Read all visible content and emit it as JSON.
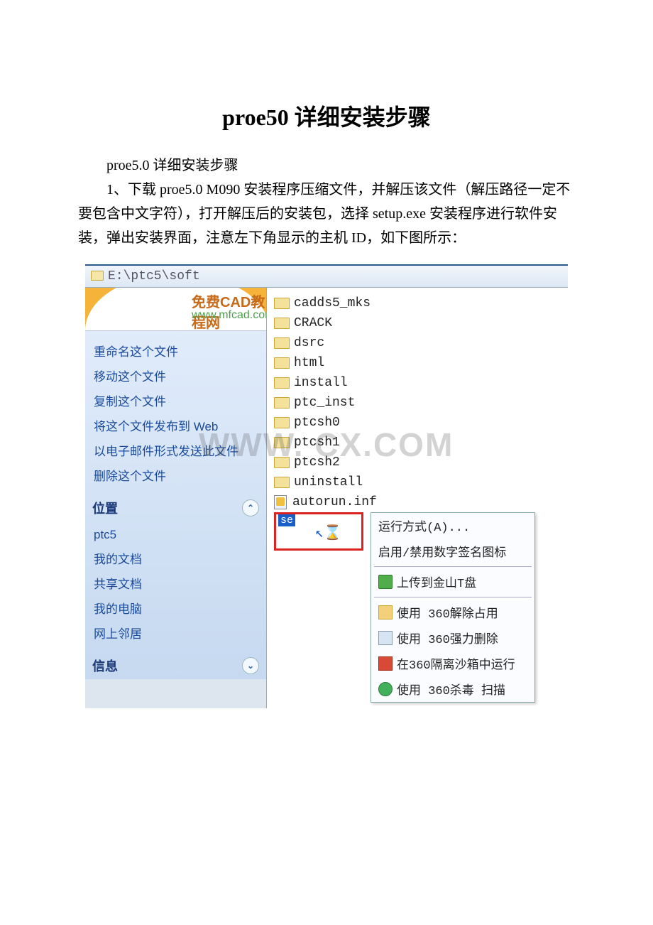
{
  "document": {
    "title": "proe50 详细安装步骤",
    "subtitle": "proe5.0 详细安装步骤",
    "paragraph1": "1、下载 proe5.0 M090 安装程序压缩文件，并解压该文件（解压路径一定不要包含中文字符），打开解压后的安装包，选择 setup.exe 安装程序进行软件安装，弹出安装界面，注意左下角显示的主机 ID，如下图所示："
  },
  "explorer": {
    "address": "E:\\ptc5\\soft",
    "banner": {
      "line1": "免费CAD教程网",
      "line2": "www.mfcad.com"
    },
    "tasks": {
      "rename": "重命名这个文件",
      "move": "移动这个文件",
      "copy": "复制这个文件",
      "publish": "将这个文件发布到 Web",
      "email": "以电子邮件形式发送此文件",
      "delete": "删除这个文件"
    },
    "places_header": "位置",
    "places": {
      "p1": "ptc5",
      "p2": "我的文档",
      "p3": "共享文档",
      "p4": "我的电脑",
      "p5": "网上邻居"
    },
    "info_header": "信息",
    "files": {
      "f0": "cadds5_mks",
      "f1": "CRACK",
      "f2": "dsrc",
      "f3": "html",
      "f4": "install",
      "f5": "ptc_inst",
      "f6": "ptcsh0",
      "f7": "ptcsh1",
      "f8": "ptcsh2",
      "f9": "uninstall",
      "f10": "autorun.inf",
      "f11_prefix": "se"
    },
    "context_menu": {
      "runas": "运行方式(A)...",
      "sig": "启用/禁用数字签名图标",
      "upload": "上传到金山T盘",
      "unlock": "使用 360解除占用",
      "forcedel": "使用 360强力删除",
      "sandbox": "在360隔离沙箱中运行",
      "scan": "使用 360杀毒 扫描"
    }
  },
  "watermark": "WWW.        CX.COM"
}
